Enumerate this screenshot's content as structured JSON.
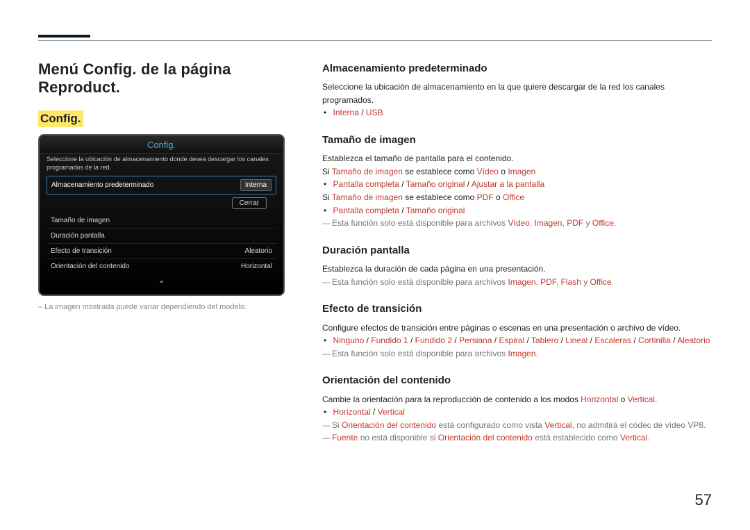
{
  "page_number": "57",
  "title": "Menú Config. de la página Reproduct.",
  "config_highlight": "Config.",
  "screenshot": {
    "title": "Config.",
    "subtitle": "Seleccione la ubicación de almacenamiento donde desea descargar los canales programados de la red.",
    "rows": [
      {
        "label": "Almacenamiento predeterminado",
        "value": "Interna",
        "selected": true
      },
      {
        "label": "Tamaño de imagen",
        "value": ""
      },
      {
        "label": "Duración pantalla",
        "value": ""
      },
      {
        "label": "Efecto de transición",
        "value": "Aleatorio"
      },
      {
        "label": "Orientación del contenido",
        "value": "Horizontal"
      }
    ],
    "close": "Cerrar"
  },
  "caption": "– La imagen mostrada puede variar dependiendo del modelo.",
  "sections": {
    "almacenamiento": {
      "heading": "Almacenamiento predeterminado",
      "body": "Seleccione la ubicación de almacenamiento en la que quiere descargar de la red los canales programados.",
      "opt1": "Interna",
      "sep": " / ",
      "opt2": "USB"
    },
    "tamano": {
      "heading": "Tamaño de imagen",
      "body1": "Establezca el tamaño de pantalla para el contenido.",
      "line2a": "Si ",
      "line2b": "Tamaño de imagen",
      "line2c": " se establece como ",
      "line2d": "Vídeo",
      "line2e": " o ",
      "line2f": "Imagen",
      "opt_a1": "Pantalla completa",
      "opt_a2": "Tamaño original",
      "opt_a3": "Ajustar a la pantalla",
      "line3a": "Si ",
      "line3b": "Tamaño de imagen",
      "line3c": " se establece como ",
      "line3d": "PDF",
      "line3e": " o ",
      "line3f": "Office",
      "opt_b1": "Pantalla completa",
      "opt_b2": "Tamaño original",
      "note_a": "Esta función solo está disponible para archivos ",
      "note_v": "Vídeo",
      "note_i": "Imagen",
      "note_p": "PDF",
      "note_y": " y ",
      "note_o": "Office",
      "note_dot": "."
    },
    "duracion": {
      "heading": "Duración pantalla",
      "body": "Establezca la duración de cada página en una presentación.",
      "note_a": "Esta función solo está disponible para archivos ",
      "n1": "Imagen",
      "n2": "PDF",
      "n3": "Flash",
      "ny": " y ",
      "n4": "Office",
      "dot": "."
    },
    "efecto": {
      "heading": "Efecto de transición",
      "body": "Configure efectos de transición entre páginas o escenas en una presentación o archivo de vídeo.",
      "o1": "Ninguno",
      "o2": "Fundido 1",
      "o3": "Fundido 2",
      "o4": "Persiana",
      "o5": "Espiral",
      "o6": "Tablero",
      "o7": "Lineal",
      "o8": "Escaleras",
      "o9": "Cortinilla",
      "o10": "Aleatorio",
      "note_a": "Esta función solo está disponible para archivos ",
      "n1": "Imagen",
      "dot": "."
    },
    "orient": {
      "heading": "Orientación del contenido",
      "body_a": "Cambie la orientación para la reproducción de contenido a los modos ",
      "body_h": "Horizontal",
      "body_o": " o ",
      "body_v": "Vertical",
      "body_dot": ".",
      "o1": "Horizontal",
      "o2": "Vertical",
      "note1_a": "Si ",
      "note1_b": "Orientación del contenido",
      "note1_c": " está configurado como vista ",
      "note1_d": "Vertical",
      "note1_e": ", no admitirá el códec de vídeo VP8.",
      "note2_a": "Fuente",
      "note2_b": " no está disponible si ",
      "note2_c": "Orientación del contenido",
      "note2_d": " está establecido como ",
      "note2_e": "Vertical",
      "note2_f": "."
    },
    "slash": " / ",
    "comma": ", "
  }
}
